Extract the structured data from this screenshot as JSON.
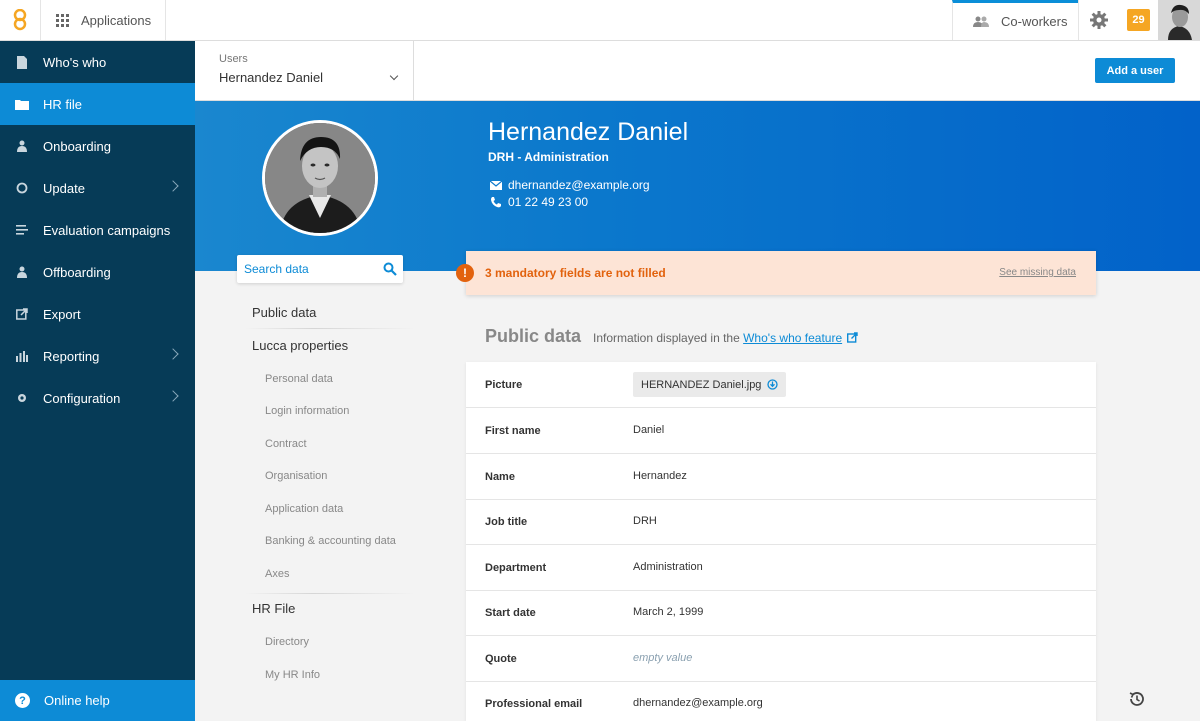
{
  "topbar": {
    "apps_label": "Applications",
    "coworkers_label": "Co-workers",
    "notification_count": "29"
  },
  "sidebar": {
    "items": [
      {
        "label": "Who's who",
        "icon": "document-icon"
      },
      {
        "label": "HR file",
        "icon": "folder-icon"
      },
      {
        "label": "Onboarding",
        "icon": "person-icon"
      },
      {
        "label": "Update",
        "icon": "refresh-icon"
      },
      {
        "label": "Evaluation campaigns",
        "icon": "list-icon"
      },
      {
        "label": "Offboarding",
        "icon": "person-icon"
      },
      {
        "label": "Export",
        "icon": "export-icon"
      },
      {
        "label": "Reporting",
        "icon": "bar-chart-icon"
      },
      {
        "label": "Configuration",
        "icon": "gear-icon"
      }
    ],
    "help_label": "Online help"
  },
  "subheader": {
    "users_caption": "Users",
    "selected_user": "Hernandez Daniel",
    "add_user_label": "Add a user"
  },
  "profile": {
    "name": "Hernandez Daniel",
    "department": "DRH - Administration",
    "email": "dhernandez@example.org",
    "phone": "01 22 49 23 00"
  },
  "search": {
    "placeholder": "Search data"
  },
  "nav": {
    "public_data": "Public data",
    "lucca_properties": "Lucca properties",
    "lucca_sub": [
      "Personal data",
      "Login information",
      "Contract",
      "Organisation",
      "Application data",
      "Banking & accounting data",
      "Axes"
    ],
    "hr_file": "HR File",
    "hr_sub": [
      "Directory",
      "My HR Info"
    ]
  },
  "warning": {
    "message": "3 mandatory fields are not filled",
    "link": "See missing data"
  },
  "section": {
    "title": "Public data",
    "info_prefix": "Information displayed in the",
    "info_link": "Who's who feature"
  },
  "fields": [
    {
      "label": "Picture",
      "value": "HERNANDEZ Daniel.jpg"
    },
    {
      "label": "First name",
      "value": "Daniel"
    },
    {
      "label": "Name",
      "value": "Hernandez"
    },
    {
      "label": "Job title",
      "value": "DRH"
    },
    {
      "label": "Department",
      "value": "Administration"
    },
    {
      "label": "Start date",
      "value": "March 2, 1999"
    },
    {
      "label": "Quote",
      "value": "empty value"
    },
    {
      "label": "Professional email",
      "value": "dhernandez@example.org"
    }
  ]
}
